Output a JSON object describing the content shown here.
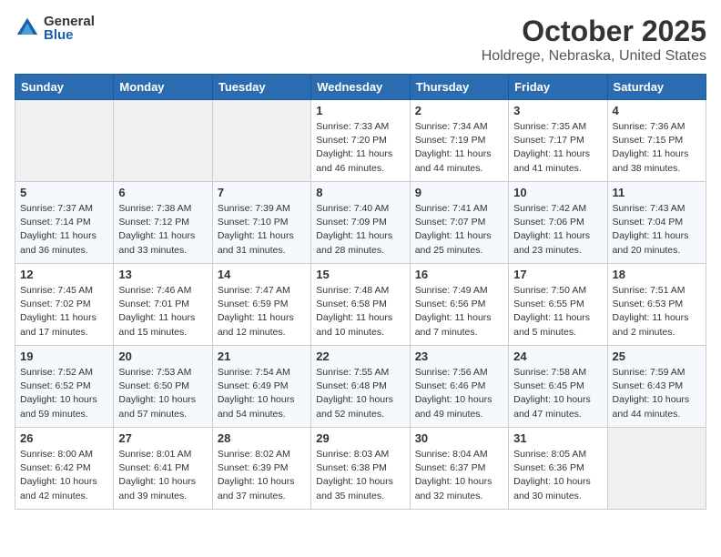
{
  "logo": {
    "general": "General",
    "blue": "Blue"
  },
  "title": "October 2025",
  "location": "Holdrege, Nebraska, United States",
  "days_of_week": [
    "Sunday",
    "Monday",
    "Tuesday",
    "Wednesday",
    "Thursday",
    "Friday",
    "Saturday"
  ],
  "weeks": [
    [
      {
        "day": "",
        "info": ""
      },
      {
        "day": "",
        "info": ""
      },
      {
        "day": "",
        "info": ""
      },
      {
        "day": "1",
        "info": "Sunrise: 7:33 AM\nSunset: 7:20 PM\nDaylight: 11 hours and 46 minutes."
      },
      {
        "day": "2",
        "info": "Sunrise: 7:34 AM\nSunset: 7:19 PM\nDaylight: 11 hours and 44 minutes."
      },
      {
        "day": "3",
        "info": "Sunrise: 7:35 AM\nSunset: 7:17 PM\nDaylight: 11 hours and 41 minutes."
      },
      {
        "day": "4",
        "info": "Sunrise: 7:36 AM\nSunset: 7:15 PM\nDaylight: 11 hours and 38 minutes."
      }
    ],
    [
      {
        "day": "5",
        "info": "Sunrise: 7:37 AM\nSunset: 7:14 PM\nDaylight: 11 hours and 36 minutes."
      },
      {
        "day": "6",
        "info": "Sunrise: 7:38 AM\nSunset: 7:12 PM\nDaylight: 11 hours and 33 minutes."
      },
      {
        "day": "7",
        "info": "Sunrise: 7:39 AM\nSunset: 7:10 PM\nDaylight: 11 hours and 31 minutes."
      },
      {
        "day": "8",
        "info": "Sunrise: 7:40 AM\nSunset: 7:09 PM\nDaylight: 11 hours and 28 minutes."
      },
      {
        "day": "9",
        "info": "Sunrise: 7:41 AM\nSunset: 7:07 PM\nDaylight: 11 hours and 25 minutes."
      },
      {
        "day": "10",
        "info": "Sunrise: 7:42 AM\nSunset: 7:06 PM\nDaylight: 11 hours and 23 minutes."
      },
      {
        "day": "11",
        "info": "Sunrise: 7:43 AM\nSunset: 7:04 PM\nDaylight: 11 hours and 20 minutes."
      }
    ],
    [
      {
        "day": "12",
        "info": "Sunrise: 7:45 AM\nSunset: 7:02 PM\nDaylight: 11 hours and 17 minutes."
      },
      {
        "day": "13",
        "info": "Sunrise: 7:46 AM\nSunset: 7:01 PM\nDaylight: 11 hours and 15 minutes."
      },
      {
        "day": "14",
        "info": "Sunrise: 7:47 AM\nSunset: 6:59 PM\nDaylight: 11 hours and 12 minutes."
      },
      {
        "day": "15",
        "info": "Sunrise: 7:48 AM\nSunset: 6:58 PM\nDaylight: 11 hours and 10 minutes."
      },
      {
        "day": "16",
        "info": "Sunrise: 7:49 AM\nSunset: 6:56 PM\nDaylight: 11 hours and 7 minutes."
      },
      {
        "day": "17",
        "info": "Sunrise: 7:50 AM\nSunset: 6:55 PM\nDaylight: 11 hours and 5 minutes."
      },
      {
        "day": "18",
        "info": "Sunrise: 7:51 AM\nSunset: 6:53 PM\nDaylight: 11 hours and 2 minutes."
      }
    ],
    [
      {
        "day": "19",
        "info": "Sunrise: 7:52 AM\nSunset: 6:52 PM\nDaylight: 10 hours and 59 minutes."
      },
      {
        "day": "20",
        "info": "Sunrise: 7:53 AM\nSunset: 6:50 PM\nDaylight: 10 hours and 57 minutes."
      },
      {
        "day": "21",
        "info": "Sunrise: 7:54 AM\nSunset: 6:49 PM\nDaylight: 10 hours and 54 minutes."
      },
      {
        "day": "22",
        "info": "Sunrise: 7:55 AM\nSunset: 6:48 PM\nDaylight: 10 hours and 52 minutes."
      },
      {
        "day": "23",
        "info": "Sunrise: 7:56 AM\nSunset: 6:46 PM\nDaylight: 10 hours and 49 minutes."
      },
      {
        "day": "24",
        "info": "Sunrise: 7:58 AM\nSunset: 6:45 PM\nDaylight: 10 hours and 47 minutes."
      },
      {
        "day": "25",
        "info": "Sunrise: 7:59 AM\nSunset: 6:43 PM\nDaylight: 10 hours and 44 minutes."
      }
    ],
    [
      {
        "day": "26",
        "info": "Sunrise: 8:00 AM\nSunset: 6:42 PM\nDaylight: 10 hours and 42 minutes."
      },
      {
        "day": "27",
        "info": "Sunrise: 8:01 AM\nSunset: 6:41 PM\nDaylight: 10 hours and 39 minutes."
      },
      {
        "day": "28",
        "info": "Sunrise: 8:02 AM\nSunset: 6:39 PM\nDaylight: 10 hours and 37 minutes."
      },
      {
        "day": "29",
        "info": "Sunrise: 8:03 AM\nSunset: 6:38 PM\nDaylight: 10 hours and 35 minutes."
      },
      {
        "day": "30",
        "info": "Sunrise: 8:04 AM\nSunset: 6:37 PM\nDaylight: 10 hours and 32 minutes."
      },
      {
        "day": "31",
        "info": "Sunrise: 8:05 AM\nSunset: 6:36 PM\nDaylight: 10 hours and 30 minutes."
      },
      {
        "day": "",
        "info": ""
      }
    ]
  ]
}
